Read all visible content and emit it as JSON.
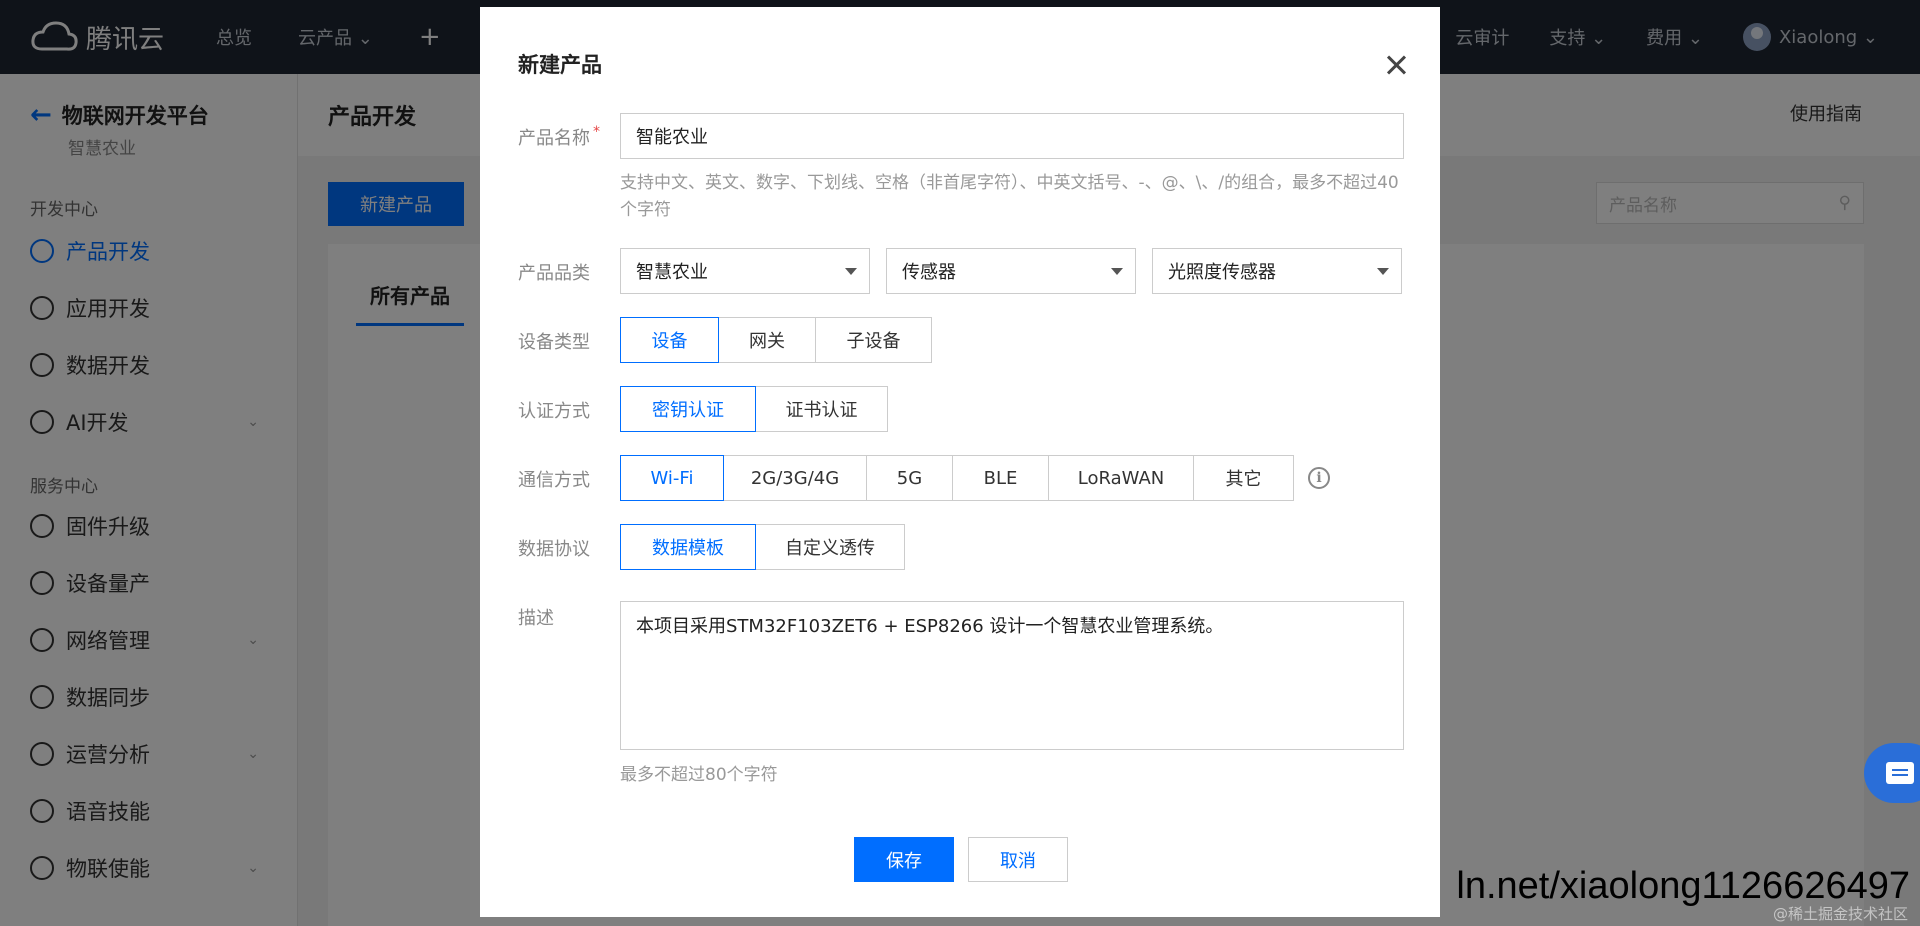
{
  "topbar": {
    "brand": "腾讯云",
    "nav": [
      "总览",
      "云产品 ⌄"
    ],
    "plus": "+",
    "right": [
      "云审计",
      "支持 ⌄",
      "费用 ⌄"
    ],
    "user": "Xiaolong ⌄"
  },
  "sidebar": {
    "title": "物联网开发平台",
    "subtitle": "智慧农业",
    "group1": "开发中心",
    "items1": [
      "产品开发",
      "应用开发",
      "数据开发",
      "AI开发"
    ],
    "group2": "服务中心",
    "items2": [
      "固件升级",
      "设备量产",
      "网络管理",
      "数据同步",
      "运营分析",
      "语音技能",
      "物联使能"
    ]
  },
  "main": {
    "title": "产品开发",
    "guide": "使用指南",
    "new_button": "新建产品",
    "search_placeholder": "产品名称",
    "tab_all": "所有产品"
  },
  "modal": {
    "title": "新建产品",
    "name_label": "产品名称",
    "required_mark": "*",
    "name_value": "智能农业",
    "name_hint": "支持中文、英文、数字、下划线、空格（非首尾字符）、中英文括号、-、@、\\、/的组合，最多不超过40个字符",
    "category_label": "产品品类",
    "category": [
      "智慧农业",
      "传感器",
      "光照度传感器"
    ],
    "device_type_label": "设备类型",
    "device_types": [
      "设备",
      "网关",
      "子设备"
    ],
    "device_type_selected": 0,
    "auth_label": "认证方式",
    "auth_types": [
      "密钥认证",
      "证书认证"
    ],
    "auth_selected": 0,
    "comm_label": "通信方式",
    "comm_types": [
      "Wi-Fi",
      "2G/3G/4G",
      "5G",
      "BLE",
      "LoRaWAN",
      "其它"
    ],
    "comm_selected": 0,
    "protocol_label": "数据协议",
    "protocols": [
      "数据模板",
      "自定义透传"
    ],
    "protocol_selected": 0,
    "desc_label": "描述",
    "desc_value": "本项目采用STM32F103ZET6 + ESP8266 设计一个智慧农业管理系统。",
    "desc_hint": "最多不超过80个字符",
    "save": "保存",
    "cancel": "取消"
  },
  "watermark": "ln.net/xiaolong1126626497",
  "watermark_small": "@稀土掘金技术社区",
  "colors": {
    "accent": "#006eff",
    "topbar": "#1f2733"
  }
}
